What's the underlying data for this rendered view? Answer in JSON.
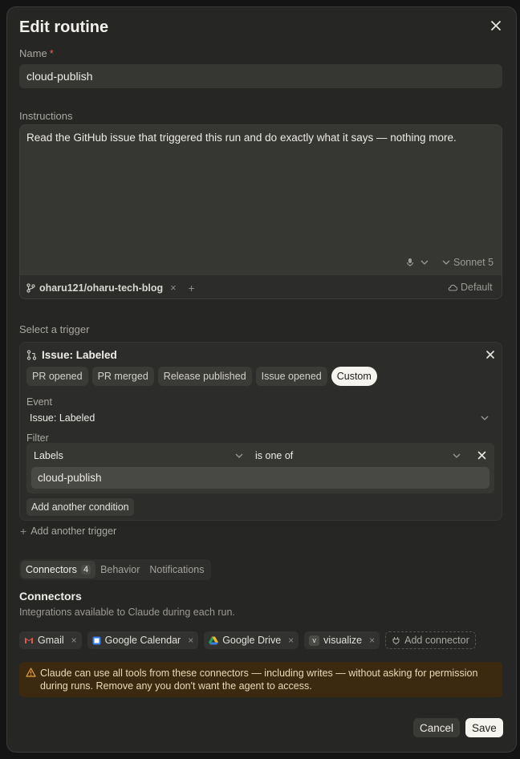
{
  "modal": {
    "title": "Edit routine",
    "name_label": "Name",
    "required_mark": "*",
    "name_value": "cloud-publish",
    "instructions_label": "Instructions",
    "instructions_value": "Read the GitHub issue that triggered this run and do exactly what it says — nothing more.",
    "model_label": "Sonnet 5",
    "repo": "oharu121/oharu-tech-blog",
    "environment": "Default"
  },
  "trigger": {
    "section_label": "Select a trigger",
    "current": "Issue: Labeled",
    "presets": [
      "PR opened",
      "PR merged",
      "Release published",
      "Issue opened",
      "Custom"
    ],
    "active_preset": "Custom",
    "event_label": "Event",
    "event_value": "Issue: Labeled",
    "filter_label": "Filter",
    "condition_field": "Labels",
    "condition_operator": "is one of",
    "condition_value": "cloud-publish",
    "add_condition_label": "Add another condition",
    "add_trigger_label": "Add another trigger"
  },
  "tabs": [
    {
      "label": "Connectors",
      "badge": "4"
    },
    {
      "label": "Behavior"
    },
    {
      "label": "Notifications"
    }
  ],
  "connectors": {
    "heading": "Connectors",
    "description": "Integrations available to Claude during each run.",
    "items": [
      {
        "name": "Gmail",
        "icon": "gmail-icon"
      },
      {
        "name": "Google Calendar",
        "icon": "google-calendar-icon"
      },
      {
        "name": "Google Drive",
        "icon": "google-drive-icon"
      },
      {
        "name": "visualize",
        "icon": "visualize-icon"
      }
    ],
    "add_label": "Add connector",
    "warning": "Claude can use all tools from these connectors — including writes — without asking for permission during runs. Remove any you don't want the agent to access."
  },
  "footer": {
    "cancel": "Cancel",
    "save": "Save"
  },
  "colors": {
    "background": "#262624",
    "accent": "#f5f4ef",
    "warning_bg": "#3b2a10",
    "warning_icon": "#e8a33a",
    "required": "#e0655f"
  }
}
